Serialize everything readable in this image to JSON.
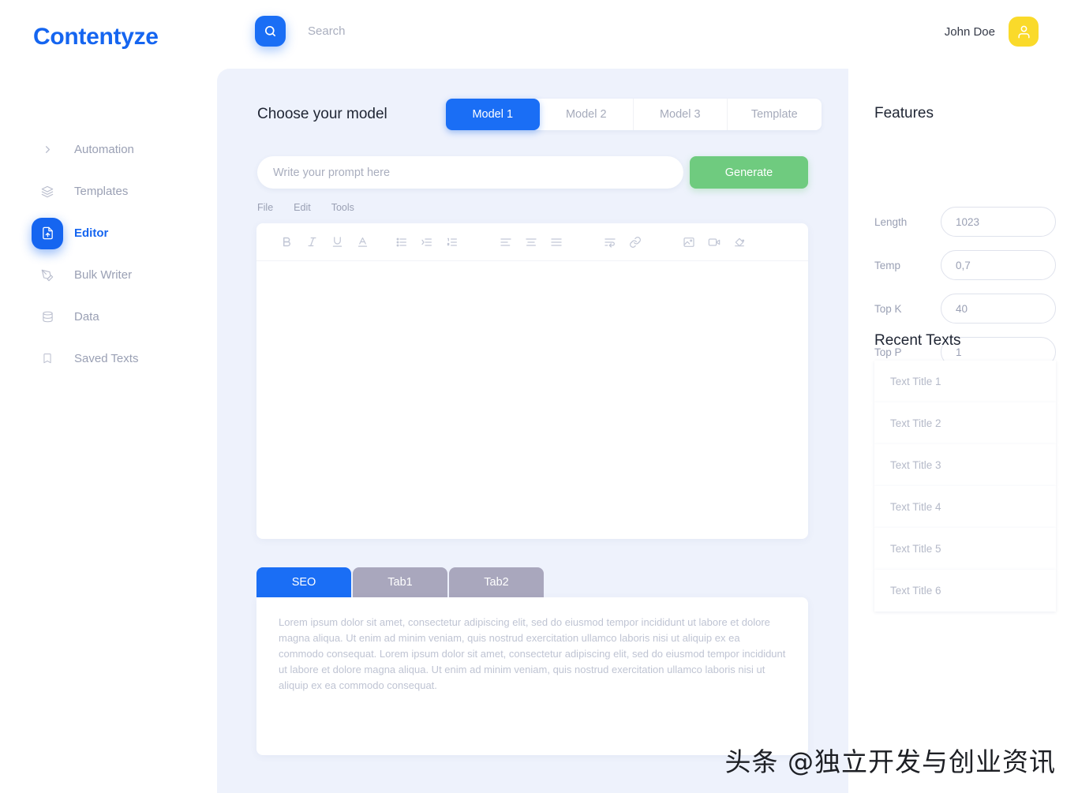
{
  "brand": "Contentyze",
  "topbar": {
    "search_placeholder": "Search",
    "search_value": "",
    "search_icon": "search-icon",
    "user_name": "John Doe",
    "avatar_icon": "user-icon"
  },
  "sidebar": {
    "items": [
      {
        "label": "Automation",
        "icon": "chevron-right-icon",
        "active": false
      },
      {
        "label": "Templates",
        "icon": "layers-icon",
        "active": false
      },
      {
        "label": "Editor",
        "icon": "document-edit-icon",
        "active": true
      },
      {
        "label": "Bulk Writer",
        "icon": "pen-icon",
        "active": false
      },
      {
        "label": "Data",
        "icon": "database-icon",
        "active": false
      },
      {
        "label": "Saved Texts",
        "icon": "bookmark-icon",
        "active": false
      }
    ]
  },
  "main": {
    "model_title": "Choose your model",
    "model_tabs": [
      {
        "label": "Model 1",
        "active": true
      },
      {
        "label": "Model 2",
        "active": false
      },
      {
        "label": "Model 3",
        "active": false
      },
      {
        "label": "Template",
        "active": false
      }
    ],
    "prompt_placeholder": "Write your prompt here",
    "prompt_value": "",
    "generate_label": "Generate",
    "menu": [
      "File",
      "Edit",
      "Tools"
    ],
    "toolbar_icons": [
      "bold-icon",
      "italic-icon",
      "underline-icon",
      "text-color-icon",
      "bulleted-list-icon",
      "indent-increase-icon",
      "numbered-list-icon",
      "align-left-icon",
      "align-center-icon",
      "align-justify-icon",
      "line-wrap-icon",
      "link-icon",
      "image-icon",
      "video-icon",
      "fill-color-icon"
    ],
    "editor_content": "",
    "bottom_tabs": [
      {
        "label": "SEO",
        "active": true
      },
      {
        "label": "Tab1",
        "active": false
      },
      {
        "label": "Tab2",
        "active": false
      }
    ],
    "bottom_panel_text": "Lorem ipsum dolor sit amet, consectetur adipiscing elit, sed do eiusmod tempor incididunt ut labore et dolore magna aliqua. Ut enim ad minim veniam, quis nostrud exercitation ullamco laboris nisi ut aliquip ex ea commodo consequat. Lorem ipsum dolor sit amet, consectetur adipiscing elit, sed do eiusmod tempor incididunt ut labore et dolore magna aliqua. Ut enim ad minim veniam, quis nostrud exercitation ullamco laboris nisi ut aliquip ex ea commodo consequat."
  },
  "right": {
    "features_title": "Features",
    "features": [
      {
        "label": "Length",
        "value": "1023"
      },
      {
        "label": "Temp",
        "value": "0,7"
      },
      {
        "label": "Top K",
        "value": "40"
      },
      {
        "label": "Top P",
        "value": "1"
      }
    ],
    "recent_title": "Recent Texts",
    "recent_items": [
      "Text Title 1",
      "Text Title 2",
      "Text Title 3",
      "Text Title 4",
      "Text Title 5",
      "Text Title 6"
    ]
  },
  "watermark": "头条 @独立开发与创业资讯",
  "colors": {
    "brand_blue": "#1565f0",
    "accent_blue": "#1a6ef5",
    "generate_green": "#6fcb7f",
    "avatar_yellow": "#fada2a",
    "panel_bg": "#eef2fc",
    "inactive_tab": "#a9a7bd"
  }
}
